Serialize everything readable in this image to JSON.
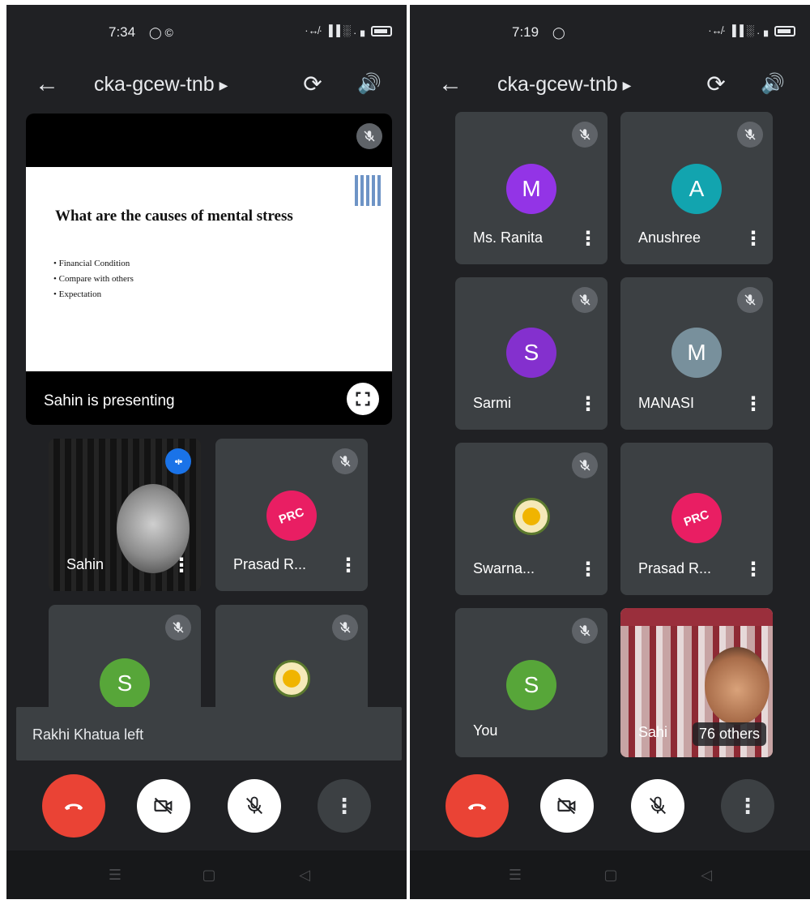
{
  "left": {
    "status": {
      "time": "7:34",
      "extra_icons": "◯ ©",
      "signal": "·↮· ▐▐ ░ .▗"
    },
    "header": {
      "title": "cka-gcew-tnb"
    },
    "presentation": {
      "slide_title": "What are the causes of mental stress",
      "bullets": [
        "Financial Condition",
        "Compare with others",
        "Expectation"
      ],
      "label": "Sahin is presenting"
    },
    "tiles": [
      {
        "name": "Sahin",
        "speaking": true,
        "kind": "video"
      },
      {
        "name": "Prasad R...",
        "avatar_text": "PRC",
        "avatar_color": "#e91e63",
        "muted": true
      },
      {
        "avatar_text": "S",
        "avatar_color": "#57a639",
        "muted": true
      },
      {
        "kind": "seal",
        "muted": true
      }
    ],
    "toast": "Rakhi Khatua left"
  },
  "right": {
    "status": {
      "time": "7:19",
      "extra_icons": "◯",
      "signal": "·↮· ▐▐ ░ .▗"
    },
    "header": {
      "title": "cka-gcew-tnb"
    },
    "tiles": [
      {
        "name": "Ms. Ranita",
        "avatar_text": "M",
        "avatar_color": "#9334e6",
        "muted": true
      },
      {
        "name": "Anushree",
        "avatar_text": "A",
        "avatar_color": "#12a4af",
        "muted": true
      },
      {
        "name": "Sarmi",
        "avatar_text": "S",
        "avatar_color": "#8430ce",
        "muted": true
      },
      {
        "name": "MANASI",
        "avatar_text": "M",
        "avatar_color": "#78909c",
        "muted": true
      },
      {
        "name": "Swarna...",
        "kind": "seal",
        "muted": true
      },
      {
        "name": "Prasad R...",
        "avatar_text": "PRC",
        "avatar_color": "#e91e63",
        "muted": false
      },
      {
        "name": "You",
        "avatar_text": "S",
        "avatar_color": "#57a639",
        "muted": true
      },
      {
        "name": "Sahi",
        "others": "76 others",
        "kind": "video"
      }
    ]
  },
  "icons": {
    "back": "back-arrow-icon",
    "flip": "camera-flip-icon",
    "speaker": "speaker-icon",
    "mic_off": "mic-off-icon",
    "cam_off": "camera-off-icon",
    "end": "end-call-icon",
    "more": "more-vert-icon"
  },
  "colors": {
    "end_call": "#ea4335",
    "speaking": "#1a73e8",
    "background": "#202124",
    "tile": "#3c4043"
  }
}
